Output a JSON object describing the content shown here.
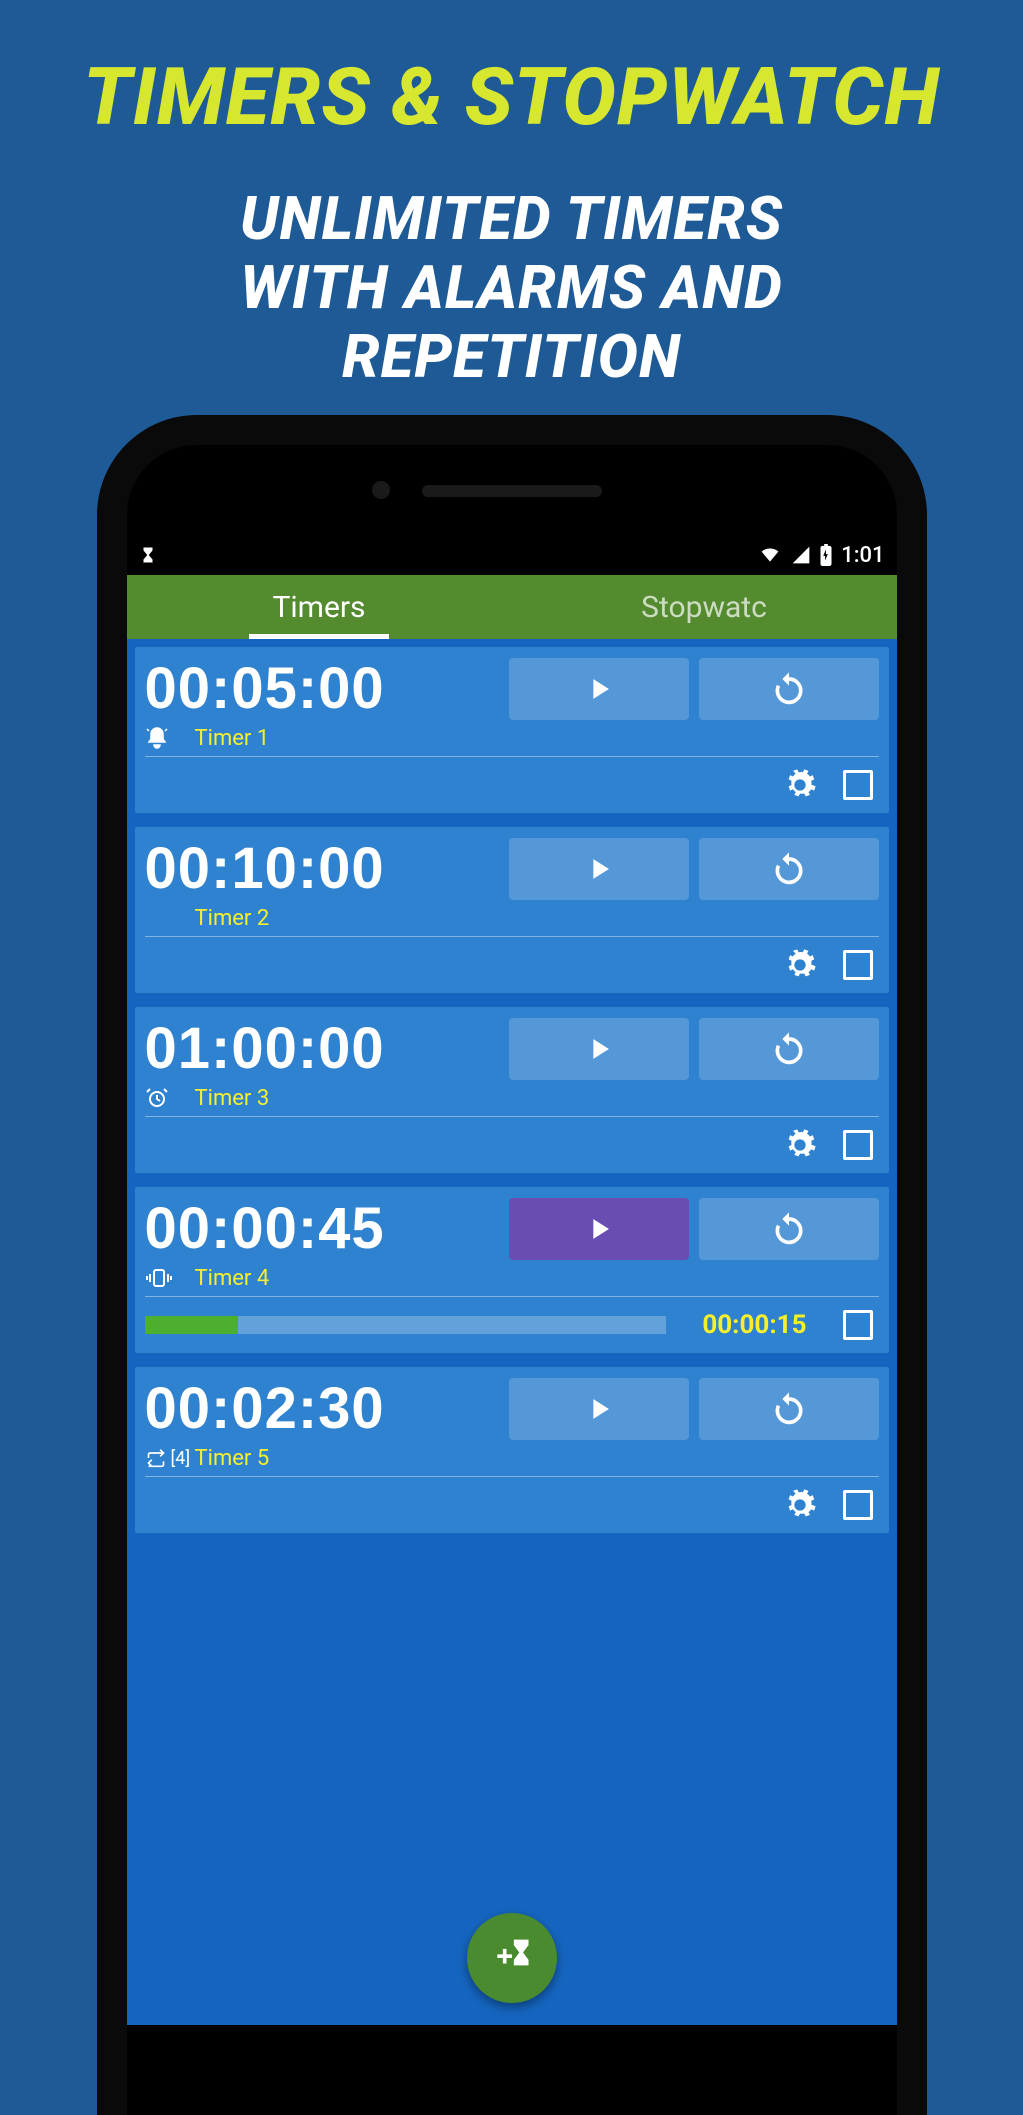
{
  "promo": {
    "title": "TIMERS & STOPWATCH",
    "subtitle_l1": "UNLIMITED TIMERS",
    "subtitle_l2": "WITH ALARMS AND",
    "subtitle_l3": "REPETITION"
  },
  "statusbar": {
    "time": "1:01"
  },
  "tabs": {
    "active": "Timers",
    "inactive": "Stopwatc"
  },
  "timers": [
    {
      "time": "00:05:00",
      "name": "Timer 1",
      "alarm_type": "bell",
      "running": false,
      "show_gear": true,
      "elapsed": null,
      "progress_pct": null,
      "repeat": null
    },
    {
      "time": "00:10:00",
      "name": "Timer 2",
      "alarm_type": null,
      "running": false,
      "show_gear": true,
      "elapsed": null,
      "progress_pct": null,
      "repeat": null
    },
    {
      "time": "01:00:00",
      "name": "Timer 3",
      "alarm_type": "alarm",
      "running": false,
      "show_gear": true,
      "elapsed": null,
      "progress_pct": null,
      "repeat": null
    },
    {
      "time": "00:00:45",
      "name": "Timer 4",
      "alarm_type": "vibrate",
      "running": true,
      "show_gear": false,
      "elapsed": "00:00:15",
      "progress_pct": 18,
      "repeat": null
    },
    {
      "time": "00:02:30",
      "name": "Timer 5",
      "alarm_type": "repeat",
      "running": false,
      "show_gear": true,
      "elapsed": null,
      "progress_pct": null,
      "repeat": "[4]"
    }
  ]
}
